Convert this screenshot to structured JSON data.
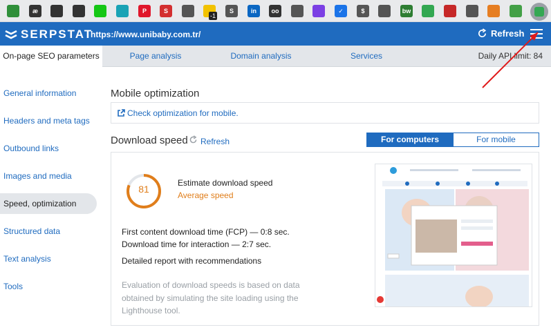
{
  "toolbar": {
    "extensions": [
      {
        "name": "bar-chart-ext-icon",
        "color": "#2f8f3a",
        "glyph": ""
      },
      {
        "name": "ae-ext-icon",
        "color": "#333333",
        "glyph": "æ"
      },
      {
        "name": "pen-ext-icon",
        "color": "#333333",
        "glyph": ""
      },
      {
        "name": "chat-ext-icon",
        "color": "#333333",
        "glyph": ""
      },
      {
        "name": "green-square-ext-icon",
        "color": "#15c715",
        "glyph": ""
      },
      {
        "name": "gear-ext-icon",
        "color": "#1aa3b5",
        "glyph": ""
      },
      {
        "name": "pinterest-ext-icon",
        "color": "#e0162b",
        "glyph": "P"
      },
      {
        "name": "s-ext-icon",
        "color": "#d32f2f",
        "glyph": "S"
      },
      {
        "name": "check-ext-icon",
        "color": "#555555",
        "glyph": ""
      },
      {
        "name": "warning-ext-icon",
        "color": "#f2c200",
        "glyph": ""
      },
      {
        "name": "s-circle-ext-icon",
        "color": "#555555",
        "glyph": "S"
      },
      {
        "name": "linkedin-ext-icon",
        "color": "#0a66c2",
        "glyph": "in"
      },
      {
        "name": "oo-ext-icon",
        "color": "#333333",
        "glyph": "oo"
      },
      {
        "name": "bolt-ext-icon",
        "color": "#555555",
        "glyph": ""
      },
      {
        "name": "page-ext-icon",
        "color": "#7b3fe4",
        "glyph": ""
      },
      {
        "name": "verified-ext-icon",
        "color": "#1a73e8",
        "glyph": "✓"
      },
      {
        "name": "dollar-ext-icon",
        "color": "#555555",
        "glyph": "$"
      },
      {
        "name": "search-ext-icon",
        "color": "#555555",
        "glyph": ""
      },
      {
        "name": "bw-ext-icon",
        "color": "#2e7d32",
        "glyph": "bw"
      },
      {
        "name": "cross-ext-icon",
        "color": "#33a852",
        "glyph": ""
      },
      {
        "name": "triangle-ext-icon",
        "color": "#c62828",
        "glyph": ""
      },
      {
        "name": "hat-ext-icon",
        "color": "#555555",
        "glyph": ""
      },
      {
        "name": "bear-ext-icon",
        "color": "#e67e22",
        "glyph": ""
      },
      {
        "name": "box-ext-icon",
        "color": "#43a047",
        "glyph": ""
      }
    ],
    "badge": "-1"
  },
  "header": {
    "logo_text": "SERPSTAT",
    "site_url": "https://www.unibaby.com.tr/",
    "refresh_label": "Refresh"
  },
  "tabs": [
    {
      "label": "On-page SEO parameters"
    },
    {
      "label": "Page analysis"
    },
    {
      "label": "Domain analysis"
    },
    {
      "label": "Services"
    }
  ],
  "api_limit": "Daily API limit: 84",
  "sidebar": {
    "items": [
      {
        "label": "General information"
      },
      {
        "label": "Headers and meta tags"
      },
      {
        "label": "Outbound links"
      },
      {
        "label": "Images and media"
      },
      {
        "label": "Speed, optimization"
      },
      {
        "label": "Structured data"
      },
      {
        "label": "Text analysis"
      },
      {
        "label": "Tools"
      }
    ]
  },
  "mobile": {
    "heading": "Mobile optimization",
    "check_link": "Check optimization for mobile."
  },
  "speed": {
    "heading": "Download speed",
    "refresh_label": "Refresh",
    "toggle_computers": "For computers",
    "toggle_mobile": "For mobile",
    "score": 81,
    "score_max": 100,
    "estimate_label": "Estimate download speed",
    "rating": "Average speed",
    "fcp": "First content download time (FCP) — 0:8 sec.",
    "tti": "Download time for interaction — 2:7 sec.",
    "report_link": "Detailed report with recommendations",
    "note": [
      "Evaluation of download speeds is based on data",
      "obtained by simulating the site loading using the",
      "Lighthouse tool."
    ]
  },
  "colors": {
    "brand": "#1f6bbf",
    "score": "#e07e1b",
    "annotation_arrow": "#e01a1a"
  }
}
